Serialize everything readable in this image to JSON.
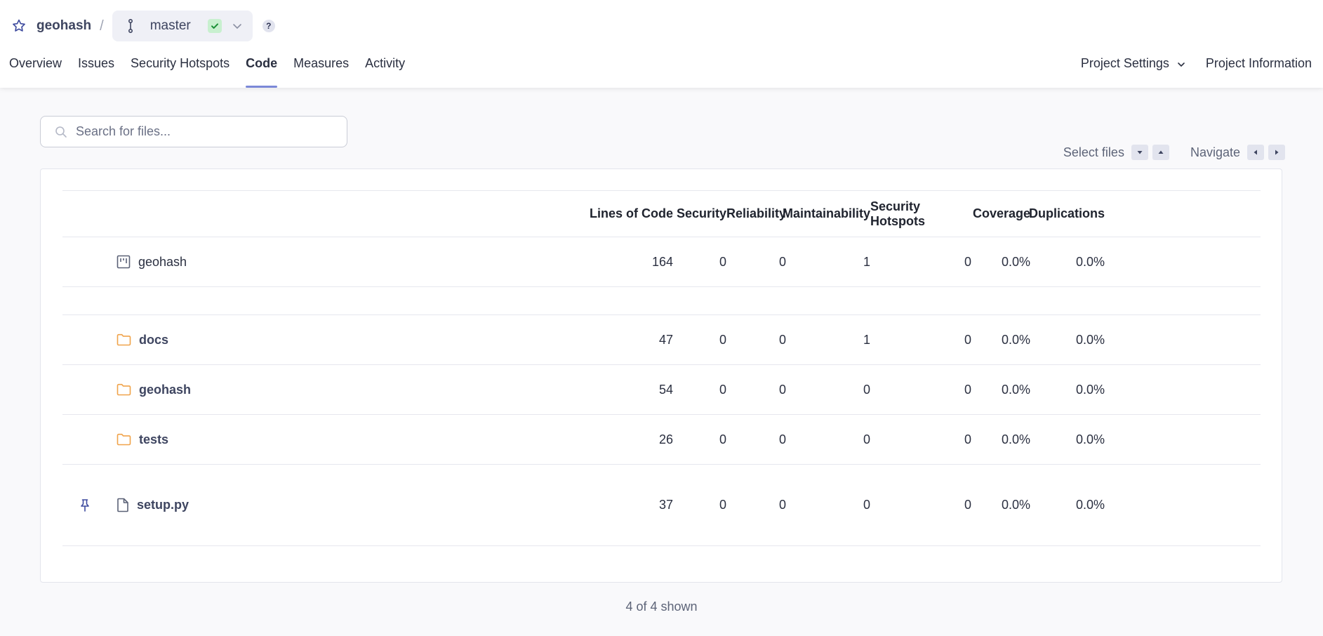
{
  "header": {
    "project": "geohash",
    "separator": "/",
    "branch": "master",
    "help": "?"
  },
  "nav": {
    "tabs": [
      {
        "label": "Overview"
      },
      {
        "label": "Issues"
      },
      {
        "label": "Security Hotspots"
      },
      {
        "label": "Code",
        "active": true
      },
      {
        "label": "Measures"
      },
      {
        "label": "Activity"
      }
    ],
    "project_settings": "Project Settings",
    "project_information": "Project Information"
  },
  "search": {
    "placeholder": "Search for files..."
  },
  "toolbar": {
    "select_files": "Select files",
    "navigate": "Navigate"
  },
  "table": {
    "columns": [
      "Lines of Code",
      "Security",
      "Reliability",
      "Maintainability",
      "Security Hotspots",
      "Coverage",
      "Duplications"
    ],
    "project_row": {
      "name": "geohash",
      "icon": "project-icon",
      "values": [
        "164",
        "0",
        "0",
        "1",
        "0",
        "0.0%",
        "0.0%"
      ]
    },
    "rows": [
      {
        "name": "docs",
        "icon": "folder-icon",
        "values": [
          "47",
          "0",
          "0",
          "1",
          "0",
          "0.0%",
          "0.0%"
        ]
      },
      {
        "name": "geohash",
        "icon": "folder-icon",
        "values": [
          "54",
          "0",
          "0",
          "0",
          "0",
          "0.0%",
          "0.0%"
        ]
      },
      {
        "name": "tests",
        "icon": "folder-icon",
        "values": [
          "26",
          "0",
          "0",
          "0",
          "0",
          "0.0%",
          "0.0%"
        ]
      },
      {
        "name": "setup.py",
        "icon": "file-icon",
        "pinned": true,
        "values": [
          "37",
          "0",
          "0",
          "0",
          "0",
          "0.0%",
          "0.0%"
        ]
      }
    ]
  },
  "footer": {
    "shown": "4 of 4 shown"
  },
  "colors": {
    "accent": "#7b88d8",
    "folder": "#f0a34a",
    "check_bg": "#c8f0cf",
    "check": "#1a8f36"
  }
}
